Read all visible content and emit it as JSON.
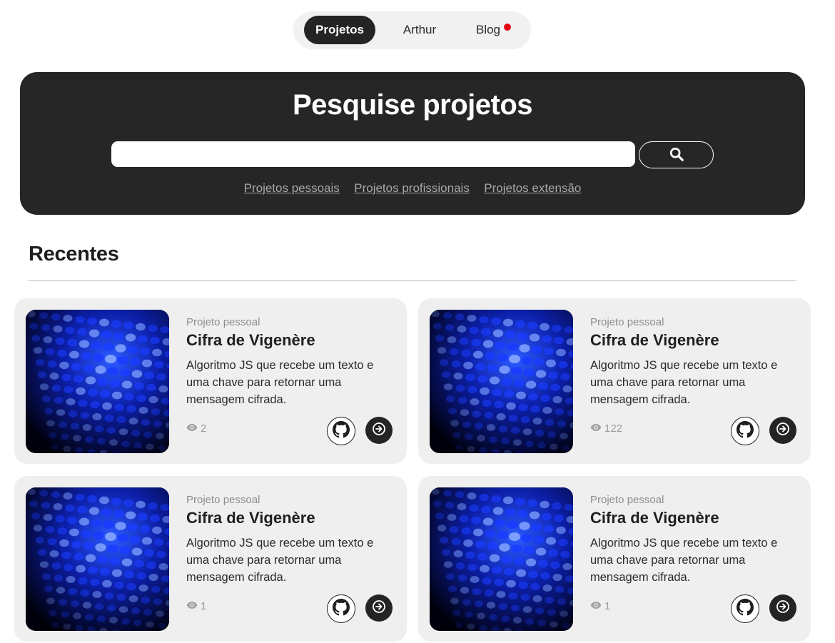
{
  "nav": {
    "items": [
      {
        "label": "Projetos",
        "active": true
      },
      {
        "label": "Arthur",
        "active": false
      },
      {
        "label": "Blog",
        "active": false,
        "notification_dot": true
      }
    ]
  },
  "hero": {
    "title": "Pesquise projetos",
    "search": {
      "value": "",
      "placeholder": ""
    },
    "search_icon": "search-icon",
    "links": [
      "Projetos pessoais",
      "Projetos profissionais",
      "Projetos extensão"
    ]
  },
  "recent": {
    "title": "Recentes",
    "cards": [
      {
        "category": "Projeto pessoal",
        "title": "Cifra de Vigenère",
        "description": "Algoritmo JS que recebe um texto e uma chave para retornar uma mensagem cifrada.",
        "views": "2"
      },
      {
        "category": "Projeto pessoal",
        "title": "Cifra de Vigenère",
        "description": "Algoritmo JS que recebe um texto e uma chave para retornar uma mensagem cifrada.",
        "views": "122"
      },
      {
        "category": "Projeto pessoal",
        "title": "Cifra de Vigenère",
        "description": "Algoritmo JS que recebe um texto e uma chave para retornar uma mensagem cifrada.",
        "views": "1"
      },
      {
        "category": "Projeto pessoal",
        "title": "Cifra de Vigenère",
        "description": "Algoritmo JS que recebe um texto e uma chave para retornar uma mensagem cifrada.",
        "views": "1"
      }
    ]
  },
  "icons": {
    "views": "eye-icon",
    "github": "github-icon",
    "open": "arrow-right-icon"
  },
  "colors": {
    "dark": "#262626",
    "card_bg": "#efefef",
    "notification": "#e3000f",
    "thumb_blue": "#1a3cff"
  }
}
